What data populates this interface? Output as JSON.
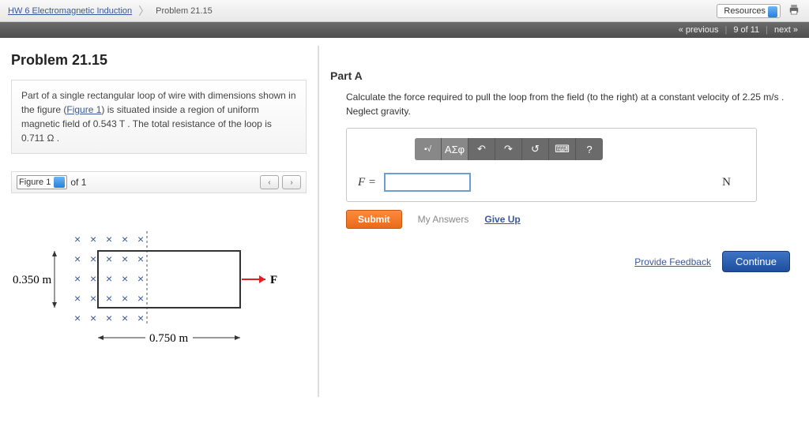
{
  "breadcrumb": {
    "parent": "HW 6 Electromagnetic Induction",
    "current": "Problem 21.15"
  },
  "topbar": {
    "resources": "Resources"
  },
  "nav": {
    "previous": "« previous",
    "position": "9 of 11",
    "next": "next »"
  },
  "problem": {
    "title": "Problem 21.15",
    "desc_prefix": "Part of a single rectangular loop of wire with dimensions shown in the figure (",
    "figure_link": "Figure 1",
    "desc_suffix": ") is situated inside a region of uniform magnetic field of 0.543 T . The total resistance of the loop is 0.711 Ω ."
  },
  "figure_bar": {
    "label": "Figure 1",
    "of_text": "of 1"
  },
  "figure": {
    "height_label": "0.350 m",
    "width_label": "0.750 m",
    "force_label": "F"
  },
  "partA": {
    "heading": "Part A",
    "text": "Calculate the force required to pull the loop from the field (to the right) at a constant velocity of 2.25 m/s . Neglect gravity.",
    "eq_label": "F =",
    "unit": "N",
    "submit": "Submit",
    "my_answers": "My Answers",
    "give_up": "Give Up"
  },
  "toolbar": {
    "sqrt": "√",
    "greek": "ΑΣφ",
    "undo": "↶",
    "redo": "↷",
    "reset": "↺",
    "keyboard": "⌨",
    "help": "?"
  },
  "bottom": {
    "feedback": "Provide Feedback",
    "continue": "Continue"
  }
}
